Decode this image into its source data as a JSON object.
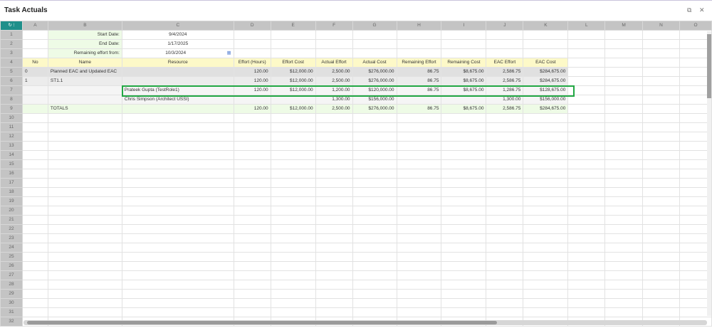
{
  "window": {
    "title": "Task Actuals",
    "restore_icon": "restore-icon",
    "close_icon": "close-icon",
    "restore": "⧉",
    "close": "✕"
  },
  "corner": "↻ ⁝",
  "columns": [
    "A",
    "B",
    "C",
    "D",
    "E",
    "F",
    "G",
    "H",
    "I",
    "J",
    "K",
    "L",
    "M",
    "N",
    "O"
  ],
  "rows": [
    {
      "n": "1",
      "style": "p",
      "cells": {
        "B": "Start Date:",
        "C": "9/4/2024"
      }
    },
    {
      "n": "2",
      "style": "p",
      "cells": {
        "B": "End Date:",
        "C": "1/17/2025"
      }
    },
    {
      "n": "3",
      "style": "p",
      "cells": {
        "B": "Remaining effort from:",
        "C": "10/3/2024"
      }
    },
    {
      "n": "4",
      "style": "hd",
      "cells": {
        "A": "No",
        "B": "Name",
        "C": "Resource",
        "D": "Effort (Hours)",
        "E": "Effort Cost",
        "F": "Actual Effort",
        "G": "Actual Cost",
        "H": "Remaining Effort",
        "I": "Remaining Cost",
        "J": "EAC Effort",
        "K": "EAC Cost"
      }
    },
    {
      "n": "5",
      "style": "g5",
      "cells": {
        "A": "0",
        "B": "Planned EAC and Updated EAC",
        "D": "120.00",
        "E": "$12,000.00",
        "F": "2,500.00",
        "G": "$276,000.00",
        "H": "86.75",
        "I": "$8,675.00",
        "J": "2,586.75",
        "K": "$284,675.00"
      }
    },
    {
      "n": "6",
      "style": "g6",
      "cells": {
        "A": "1",
        "B": "ST1.1",
        "D": "120.00",
        "E": "$12,000.00",
        "F": "2,500.00",
        "G": "$276,000.00",
        "H": "86.75",
        "I": "$8,675.00",
        "J": "2,586.75",
        "K": "$284,675.00"
      }
    },
    {
      "n": "7",
      "style": "g7",
      "cells": {
        "C": "Prateek Gupta (TestRole1)",
        "D": "120.00",
        "E": "$12,000.00",
        "F": "1,200.00",
        "G": "$120,000.00",
        "H": "86.75",
        "I": "$8,675.00",
        "J": "1,286.75",
        "K": "$128,675.00"
      }
    },
    {
      "n": "8",
      "style": "g7",
      "cells": {
        "C": "Chris Simpson (Architect USSI)",
        "F": "1,300.00",
        "G": "$156,000.00",
        "J": "1,300.00",
        "K": "$156,000.00"
      }
    },
    {
      "n": "9",
      "style": "g9",
      "cells": {
        "B": "TOTALS",
        "D": "120.00",
        "E": "$12,000.00",
        "F": "2,500.00",
        "G": "$276,000.00",
        "H": "86.75",
        "I": "$8,675.00",
        "J": "2,586.75",
        "K": "$284,675.00"
      }
    }
  ],
  "total_rows": 32,
  "colors": {
    "accent": "#1f8f8a",
    "selection": "#22a744"
  }
}
